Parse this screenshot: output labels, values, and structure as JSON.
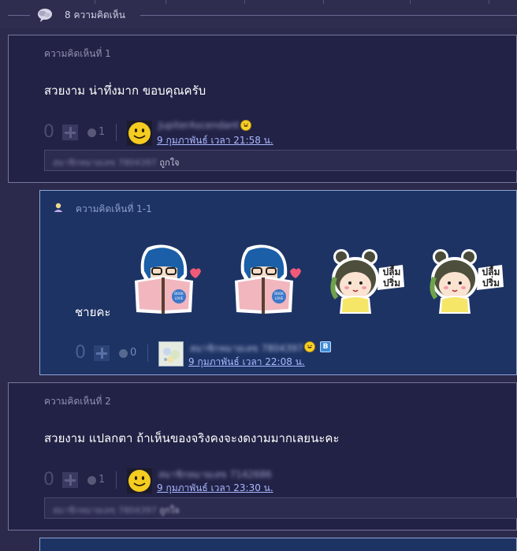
{
  "header": {
    "comment_count_label": "8 ความคิดเห็น",
    "icon": "speech-bubbles-icon"
  },
  "comments": [
    {
      "title": "ความคิดเห็นที่ 1",
      "body": "สวยงาม น่าทึ่งมาก ขอบคุณครับ",
      "score": "0",
      "emotion_count": "1",
      "username": "JupiterAscendant",
      "date": "9 กุมภาพันธ์ เวลา 21:58 น.",
      "reaction": {
        "names": "สมาชิกหมายเลข 7804397",
        "label": "ถูกใจ"
      }
    },
    {
      "title": "ความคิดเห็นที่ 1-1",
      "body": "ชายคะ",
      "score": "0",
      "emotion_count": "0",
      "username": "สมาชิกหมายเลข 7804397",
      "date": "9 กุมภาพันธ์ เวลา 22:08 น.",
      "badge_b": "B",
      "stickers": [
        {
          "name": "girl-reading-book-sticker",
          "book_text": "BOOK LOVE"
        },
        {
          "name": "girl-reading-book-sticker",
          "book_text": "BOOK LOVE"
        },
        {
          "name": "plum-prim-girl-sticker",
          "caption": "ปลื้มปริ่ม"
        },
        {
          "name": "plum-prim-girl-sticker",
          "caption": "ปลื้มปริ่ม"
        }
      ]
    },
    {
      "title": "ความคิดเห็นที่ 2",
      "body": "สวยงาม แปลกตา ถ้าเห็นของจริงคงจะงดงามมากเลยนะคะ",
      "score": "0",
      "emotion_count": "1",
      "username": "สมาชิกหมายเลข 7142686",
      "date": "9 กุมภาพันธ์ เวลา 23:30 น.",
      "reaction": {
        "names": "สมาชิกหมายเลข 7804397",
        "label": "ถูกใจ"
      }
    }
  ],
  "colors": {
    "background": "#2b2a4c",
    "card": "#222246",
    "reply_card": "#1d3364",
    "link": "#a9b8ff"
  }
}
